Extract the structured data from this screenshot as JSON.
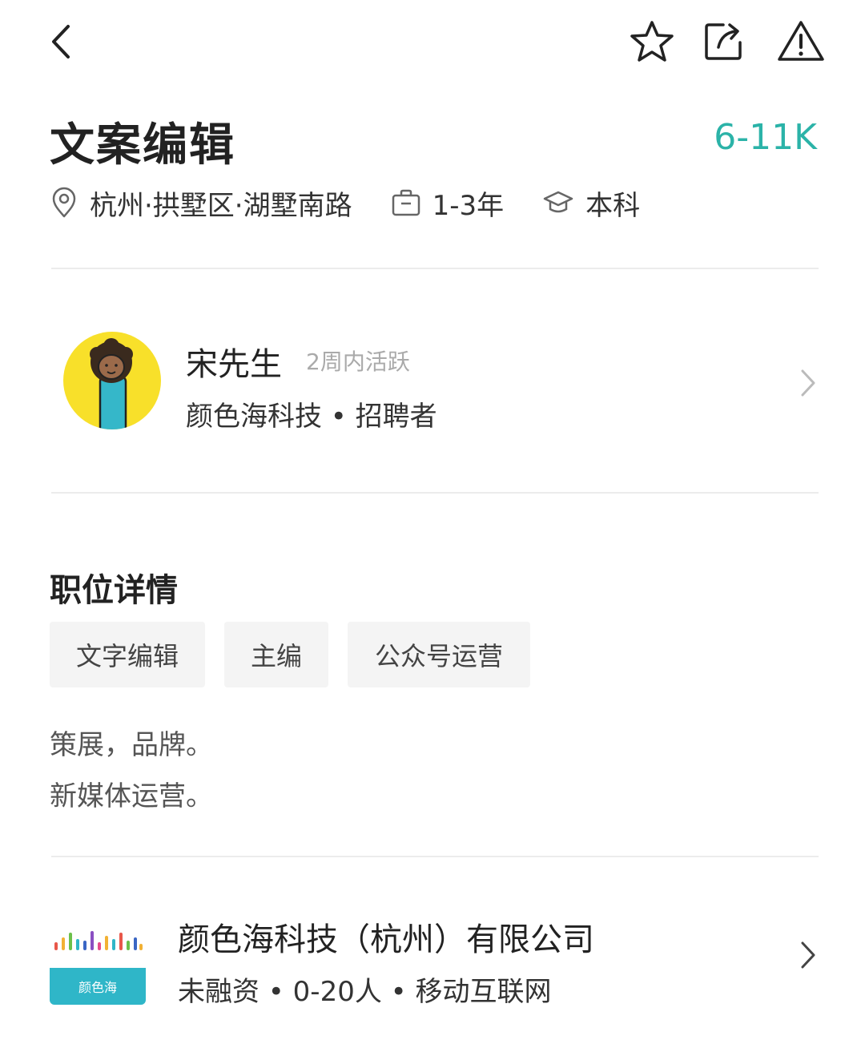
{
  "header": {
    "back_icon": "chevron-left-icon",
    "favorite_icon": "star-icon",
    "share_icon": "share-icon",
    "report_icon": "warning-triangle-icon"
  },
  "job": {
    "title": "文案编辑",
    "salary": "6-11K",
    "location": "杭州·拱墅区·湖墅南路",
    "experience": "1-3年",
    "education": "本科"
  },
  "recruiter": {
    "name": "宋先生",
    "active_status": "2周内活跃",
    "subtitle": "颜色海科技 • 招聘者"
  },
  "details": {
    "section_title": "职位详情",
    "tags": [
      "文字编辑",
      "主编",
      "公众号运营"
    ],
    "description_lines": [
      "策展，品牌。",
      "新媒体运营。"
    ]
  },
  "company": {
    "logo_text": "颜色海",
    "name": "颜色海科技（杭州）有限公司",
    "info": "未融资 • 0-20人 • 移动互联网"
  },
  "colors": {
    "accent": "#2bb3a8",
    "avatar_bg": "#f8e02a",
    "logo_band": "#2fb6c8"
  }
}
